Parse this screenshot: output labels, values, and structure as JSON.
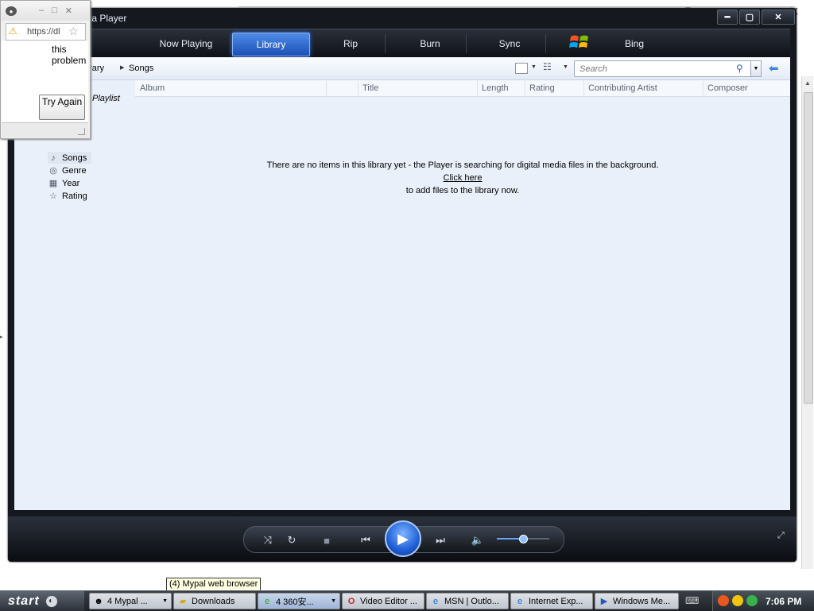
{
  "background": {
    "close_glyph": "✕",
    "mini_glyph": "⧉"
  },
  "wmp": {
    "title": "dia Player",
    "window_buttons": {
      "minimize": "━",
      "maximize": "▢",
      "close": "✕"
    },
    "tabs": [
      {
        "label": "Now Playing",
        "active": false
      },
      {
        "label": "Library",
        "active": true
      },
      {
        "label": "Rip",
        "active": false
      },
      {
        "label": "Burn",
        "active": false
      },
      {
        "label": "Sync",
        "active": false
      },
      {
        "label": "Bing",
        "active": false
      }
    ],
    "breadcrumb": [
      "brary",
      "Songs"
    ],
    "search_placeholder": "Search",
    "columns": [
      "Album",
      "Title",
      "Length",
      "Rating",
      "Contributing Artist",
      "Composer"
    ],
    "nav": {
      "playlist_label": "Playlist",
      "items": [
        {
          "label": "Songs",
          "icon": "music-note-icon",
          "selected": true
        },
        {
          "label": "Genre",
          "icon": "genre-disc-icon",
          "selected": false
        },
        {
          "label": "Year",
          "icon": "calendar-icon",
          "selected": false
        },
        {
          "label": "Rating",
          "icon": "star-icon",
          "selected": false
        }
      ]
    },
    "empty": {
      "line1": "There are no items in this library yet - the Player is searching for digital media files in the background.",
      "link": "Click here",
      "line2": "to add files to the library now."
    },
    "volume_level": 0.5
  },
  "popup": {
    "url": "https://dl",
    "text_lines": [
      "this",
      "problem"
    ],
    "try_again": "Try Again"
  },
  "tooltip": "(4) Mypal web browser",
  "taskbar": {
    "start": "start",
    "tasks": [
      {
        "label": "4 Mypal ...",
        "icon": "mypal-icon",
        "dropdown": true
      },
      {
        "label": "Downloads",
        "icon": "folder-icon",
        "dropdown": false
      },
      {
        "label": "4 360安...",
        "icon": "ie-icon",
        "dropdown": true
      },
      {
        "label": "Video Editor ...",
        "icon": "opera-icon",
        "dropdown": false
      },
      {
        "label": "MSN | Outlo...",
        "icon": "ie-icon",
        "dropdown": false
      },
      {
        "label": "Internet Exp...",
        "icon": "ie-icon",
        "dropdown": false
      },
      {
        "label": "Windows Me...",
        "icon": "media-player-icon",
        "dropdown": false
      }
    ],
    "clock": "7:06 PM"
  },
  "colors": {
    "accent_blue": "#1c50b6",
    "wmp_dark": "#15181f",
    "pane_bg": "#eaf0f9"
  }
}
